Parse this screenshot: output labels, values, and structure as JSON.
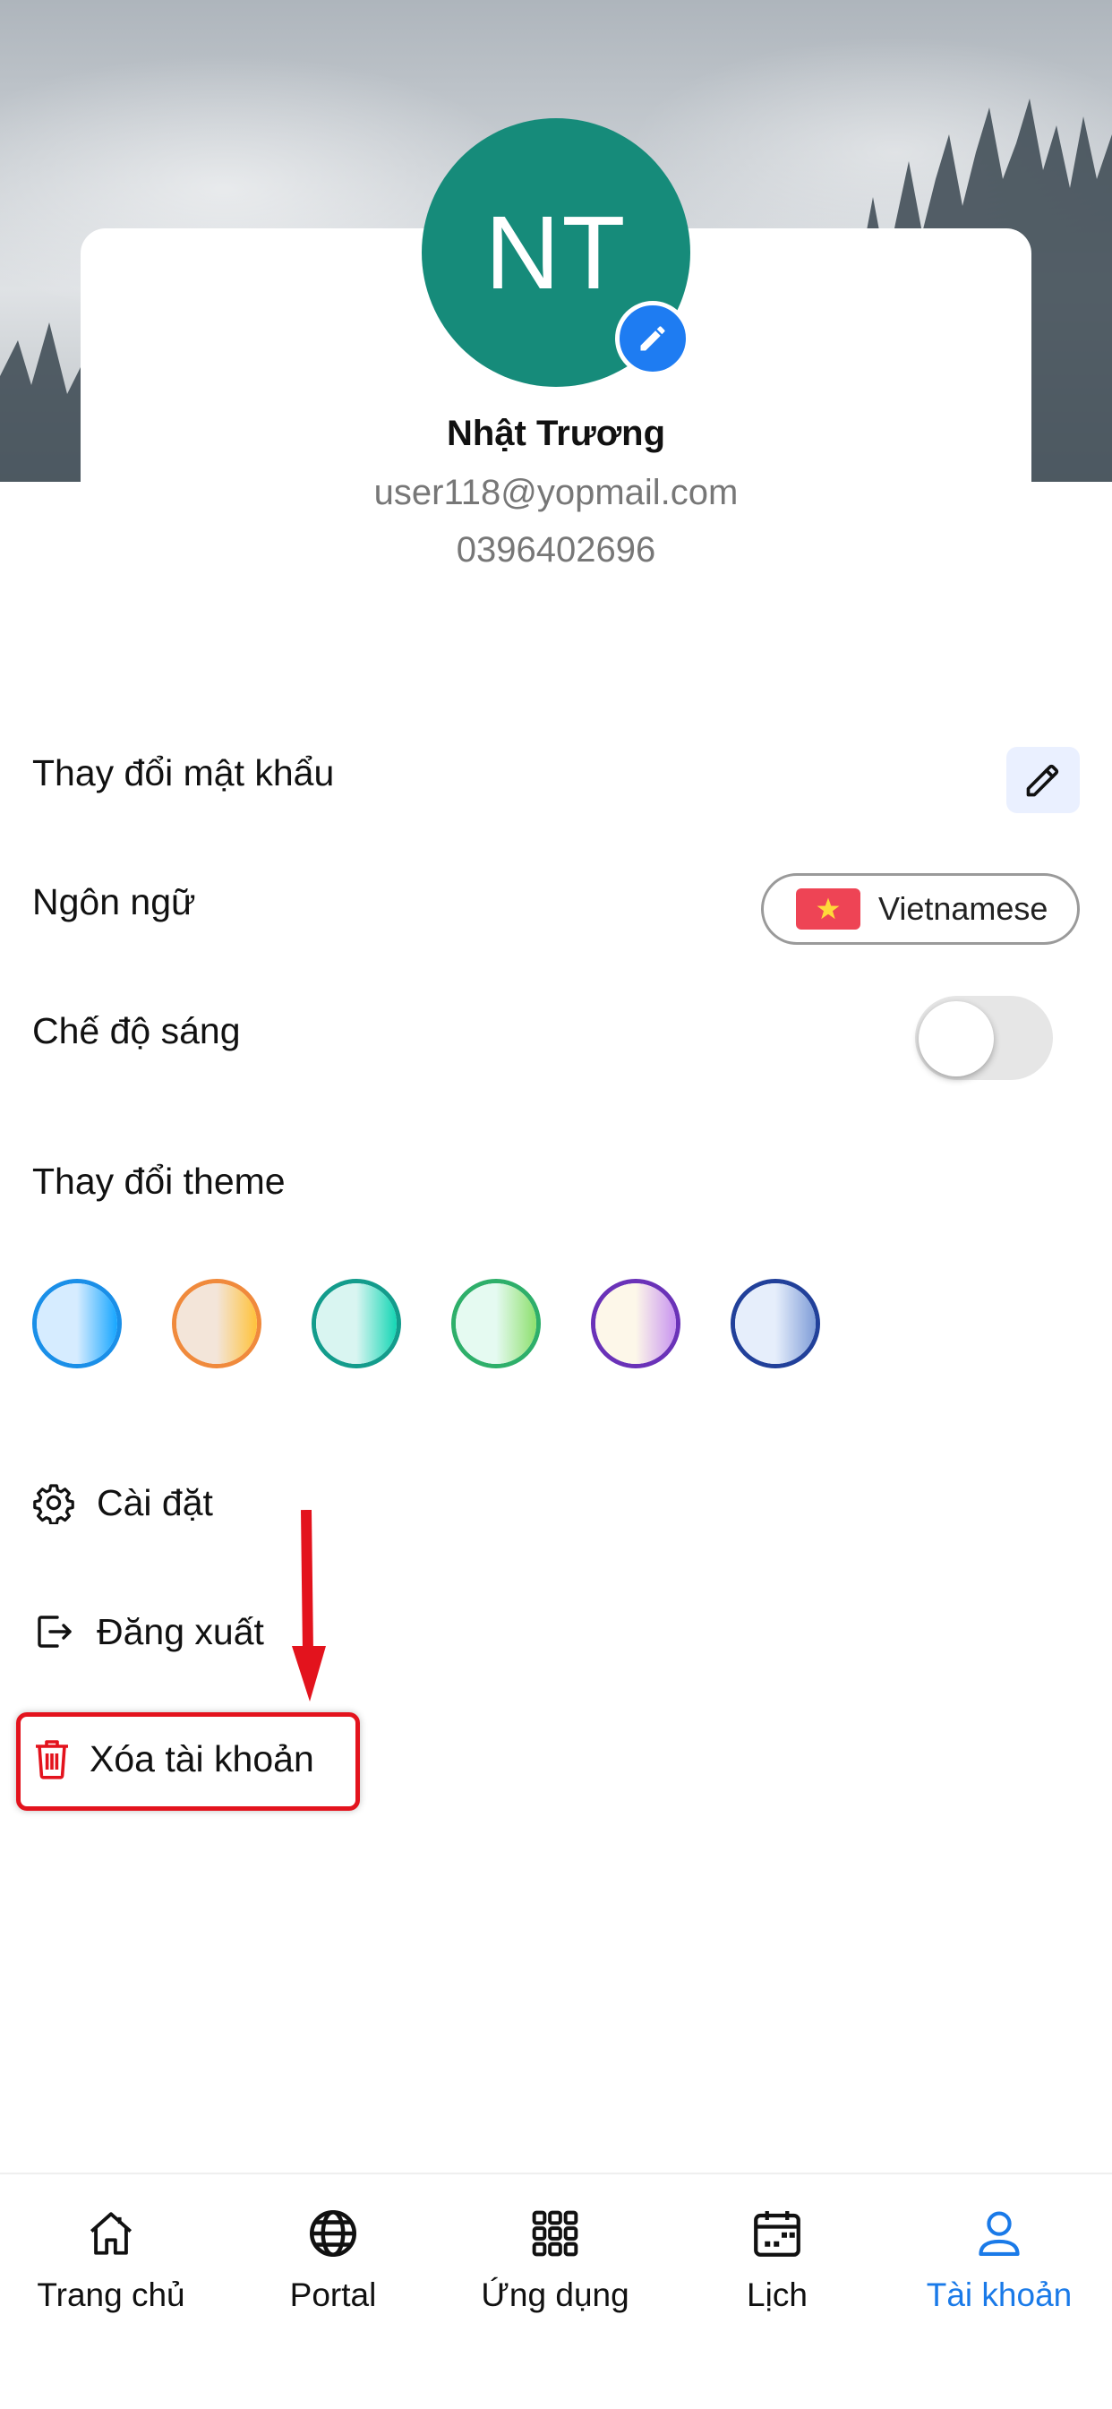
{
  "profile": {
    "initials": "NT",
    "name": "Nhật Trương",
    "email": "user118@yopmail.com",
    "phone": "0396402696"
  },
  "settings": {
    "change_password_label": "Thay đổi mật khẩu",
    "language_label": "Ngôn ngữ",
    "language_value": "Vietnamese",
    "light_mode_label": "Chế độ sáng",
    "light_mode_on": false,
    "theme_label": "Thay đổi theme"
  },
  "themes": [
    {
      "name": "blue",
      "border": "#1a8fe8",
      "left": "#d6ecff",
      "right": "#16a6ff"
    },
    {
      "name": "orange",
      "border": "#f08a3c",
      "left": "#f3e5d9",
      "right": "#ffc23a"
    },
    {
      "name": "teal",
      "border": "#139c8c",
      "left": "#d9f5f1",
      "right": "#14d6b4"
    },
    {
      "name": "green",
      "border": "#2eaf6a",
      "left": "#e5faf1",
      "right": "#8ee06e"
    },
    {
      "name": "purple",
      "border": "#6a32b8",
      "left": "#fdf7e9",
      "right": "#c894f0"
    },
    {
      "name": "navy",
      "border": "#21409a",
      "left": "#e6eefb",
      "right": "#7f9dd8"
    }
  ],
  "menu": {
    "settings_label": "Cài đặt",
    "logout_label": "Đăng xuất",
    "delete_account_label": "Xóa tài khoản"
  },
  "tabs": [
    {
      "label": "Trang chủ",
      "icon": "home-icon"
    },
    {
      "label": "Portal",
      "icon": "globe-icon"
    },
    {
      "label": "Ứng dụng",
      "icon": "apps-grid-icon"
    },
    {
      "label": "Lịch",
      "icon": "calendar-icon"
    },
    {
      "label": "Tài khoản",
      "icon": "user-icon",
      "active": true
    }
  ],
  "colors": {
    "accent": "#1a7ae8",
    "avatar": "#168b7a",
    "danger": "#e3131d"
  }
}
